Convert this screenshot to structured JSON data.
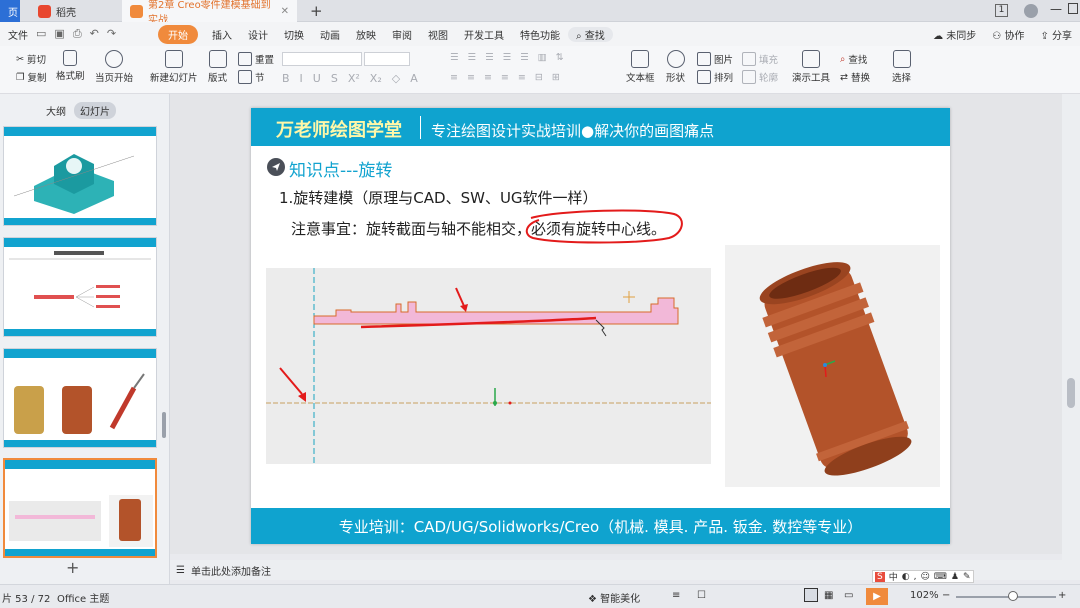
{
  "tabs": [
    {
      "label": "页"
    },
    {
      "label": "稻壳"
    },
    {
      "label": "第2章 Creo零件建模基础到实战"
    }
  ],
  "window": {
    "badge": "1"
  },
  "menu": {
    "file": "文件",
    "items": [
      "开始",
      "插入",
      "设计",
      "切换",
      "动画",
      "放映",
      "审阅",
      "视图",
      "开发工具",
      "特色功能"
    ],
    "search": "查找",
    "right": [
      "未同步",
      "协作",
      "分享"
    ]
  },
  "toolbar": {
    "cut": "剪切",
    "copy": "复制",
    "format_painter": "格式刷",
    "play_from_current": "当页开始",
    "new_slide": "新建幻灯片",
    "layout": "版式",
    "section": "节",
    "reset": "重置",
    "textbox": "文本框",
    "shapes": "形状",
    "picture": "图片",
    "fill": "填充",
    "arrange": "排列",
    "outline": "轮廓",
    "presenter_tools": "演示工具",
    "find": "查找",
    "replace": "替换",
    "select": "选择"
  },
  "left_panel": {
    "outline_tab": "大纲",
    "slides_tab": "幻灯片"
  },
  "slide": {
    "brand": "万老师绘图学堂",
    "tagline": "专注绘图设计实战培训●解决你的画图痛点",
    "section_title": "知识点---旋转",
    "item1": "1.旋转建模（原理与CAD、SW、UG软件一样）",
    "note": "注意事宜：旋转截面与轴不能相交，必须有旋转中心线。",
    "footer": "专业培训：CAD/UG/Solidworks/Creo（机械. 模具. 产品. 钣金. 数控等专业）",
    "colors": {
      "header": "#0fa3cf",
      "title": "#12a3cf",
      "profile": "#f2b8d8",
      "part": "#b3532a",
      "annotation": "#e31b1b"
    }
  },
  "notes": {
    "placeholder": "单击此处添加备注"
  },
  "status": {
    "slide_counter": "片 53 / 72",
    "theme": "Office 主题",
    "beautify": "智能美化",
    "zoom": "102%",
    "ime": "中"
  }
}
